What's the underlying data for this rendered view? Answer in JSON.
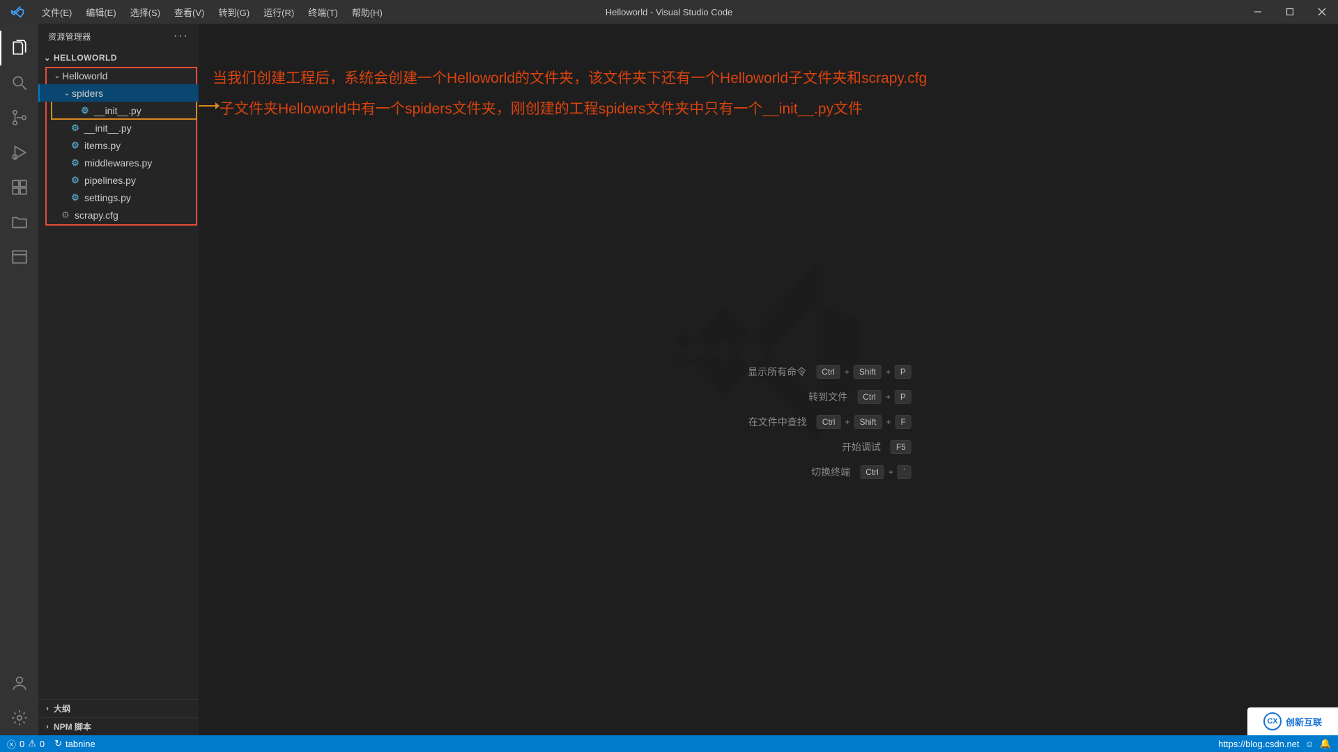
{
  "title_bar": {
    "menus": [
      "文件(E)",
      "编辑(E)",
      "选择(S)",
      "查看(V)",
      "转到(G)",
      "运行(R)",
      "终端(T)",
      "帮助(H)"
    ],
    "app_title": "Helloworld - Visual Studio Code"
  },
  "activity": {
    "items": [
      "explorer",
      "search",
      "source-control",
      "debug",
      "extensions",
      "folder",
      "panel"
    ],
    "bottom": [
      "account",
      "settings"
    ]
  },
  "sidebar": {
    "explorer_label": "资源管理器",
    "root_label": "HELLOWORLD",
    "tree": {
      "folder1": "Helloworld",
      "folder2": "spiders",
      "file_spiders_init": "__init__.py",
      "file_init": "__init__.py",
      "file_items": "items.py",
      "file_middle": "middlewares.py",
      "file_pipe": "pipelines.py",
      "file_settings": "settings.py",
      "file_cfg": "scrapy.cfg"
    },
    "sections": {
      "outline": "大纲",
      "npm": "NPM 脚本"
    }
  },
  "annotations": {
    "line1": "当我们创建工程后，系统会创建一个Helloworld的文件夹，该文件夹下还有一个Helloworld子文件夹和scrapy.cfg",
    "line2": "子文件夹Helloworld中有一个spiders文件夹，刚创建的工程spiders文件夹中只有一个__init__.py文件"
  },
  "shortcuts": {
    "rows": [
      {
        "label": "显示所有命令",
        "keys": [
          "Ctrl",
          "Shift",
          "P"
        ]
      },
      {
        "label": "转到文件",
        "keys": [
          "Ctrl",
          "P"
        ]
      },
      {
        "label": "在文件中查找",
        "keys": [
          "Ctrl",
          "Shift",
          "F"
        ]
      },
      {
        "label": "开始调试",
        "keys": [
          "F5"
        ]
      },
      {
        "label": "切换终端",
        "keys": [
          "Ctrl",
          "`"
        ]
      }
    ]
  },
  "status": {
    "errors": "0",
    "warnings": "0",
    "tabnine": "tabnine",
    "right_url": "https://blog.csdn.net"
  },
  "corner_logo": "创新互联"
}
